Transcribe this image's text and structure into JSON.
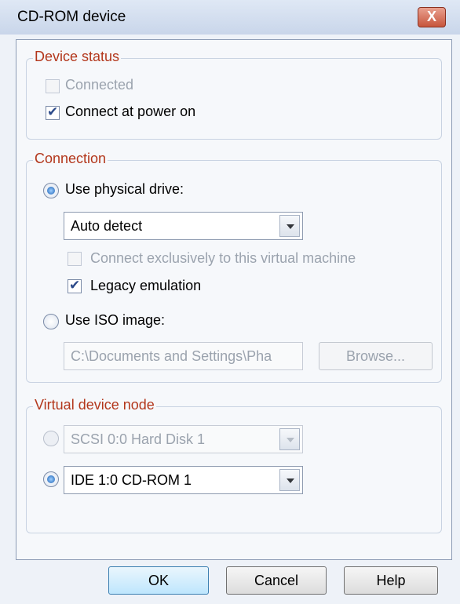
{
  "window": {
    "title": "CD-ROM device",
    "close_symbol": "X"
  },
  "device_status": {
    "legend": "Device status",
    "connected": {
      "label": "Connected",
      "checked": false,
      "enabled": false
    },
    "connect_at_power_on": {
      "label": "Connect at power on",
      "checked": true,
      "enabled": true
    }
  },
  "connection": {
    "legend": "Connection",
    "use_physical_drive": {
      "label": "Use physical drive:",
      "selected": true
    },
    "drive_select": {
      "value": "Auto detect"
    },
    "connect_exclusively": {
      "label": "Connect exclusively to this virtual machine",
      "checked": false,
      "enabled": false
    },
    "legacy_emulation": {
      "label": "Legacy emulation",
      "checked": true,
      "enabled": true
    },
    "use_iso_image": {
      "label": "Use ISO image:",
      "selected": false
    },
    "iso_path": {
      "value": "C:\\Documents and Settings\\Pha",
      "enabled": false
    },
    "browse_label": "Browse..."
  },
  "virtual_device_node": {
    "legend": "Virtual device node",
    "scsi_option": {
      "value": "SCSI 0:0  Hard Disk 1",
      "selected": false,
      "enabled": false
    },
    "ide_option": {
      "value": "IDE 1:0  CD-ROM 1",
      "selected": true,
      "enabled": true
    }
  },
  "buttons": {
    "ok": "OK",
    "cancel": "Cancel",
    "help": "Help"
  }
}
